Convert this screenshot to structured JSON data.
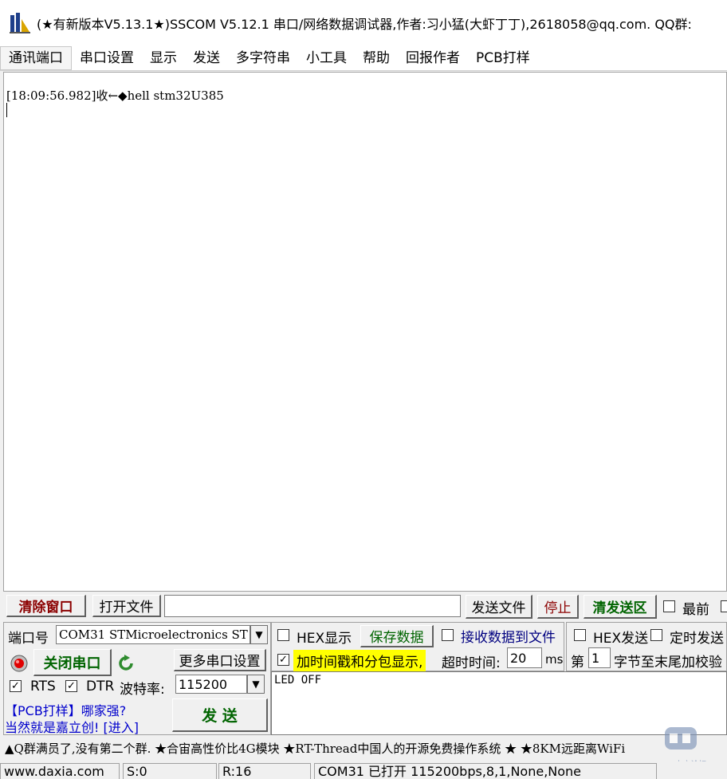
{
  "window": {
    "title": "(★有新版本V5.13.1★)SSCOM V5.12.1 串口/网络数据调试器,作者:习小猛(大虾丁丁),2618058@qq.com. QQ群:"
  },
  "menu": {
    "items": [
      "通讯端口",
      "串口设置",
      "显示",
      "发送",
      "多字符串",
      "小工具",
      "帮助",
      "回报作者",
      "PCB打样"
    ]
  },
  "receive": {
    "line": "[18:09:56.982]收←◆hell stm32U385"
  },
  "toolbar": {
    "clear_window": "清除窗口",
    "open_file": "打开文件",
    "file_path": "",
    "send_file": "发送文件",
    "stop": "停止",
    "clear_send": "清发送区",
    "topmost": "最前"
  },
  "port": {
    "label": "端口号",
    "value": "COM31 STMicroelectronics ST",
    "close_port": "关闭串口",
    "more_settings": "更多串口设置",
    "rts_label": "RTS",
    "dtr_label": "DTR",
    "baud_label": "波特率:",
    "baud_value": "115200",
    "rts_checked": "✓",
    "dtr_checked": "✓"
  },
  "options": {
    "hex_display": "HEX显示",
    "save_data": "保存数据",
    "recv_to_file": "接收数据到文件",
    "hex_send": "HEX发送",
    "timed_send": "定时发送",
    "timestamp": "加时间戳和分包显示,",
    "timestamp_checked": "✓",
    "timeout_label": "超时时间:",
    "timeout_value": "20",
    "timeout_unit": "ms",
    "byte_prefix": "第",
    "byte_value": "1",
    "byte_suffix": "字节至末尾加校验"
  },
  "send": {
    "text": "LED OFF",
    "button": "发  送"
  },
  "promo": {
    "line1": "【PCB打样】哪家强?",
    "line2": "当然就是嘉立创! [进入]"
  },
  "ticker": {
    "text": "▲Q群满员了,没有第二个群. ★合宙高性价比4G模块 ★RT-Thread中国人的开源免费操作系统 ★ ★8KM远距离WiFi"
  },
  "status": {
    "site": "www.daxia.com",
    "sent": "S:0",
    "received": "R:16",
    "port_state": "COM31 已打开  115200bps,8,1,None,None"
  },
  "watermark": "ST中文论坛",
  "colors": {
    "clear_window_text": "#8b0000",
    "green_button_text": "#006400",
    "stop_text": "#8b0000",
    "timestamp_highlight": "#ffff00",
    "link_blue": "#0000cc",
    "refresh_green": "#2e8b2e"
  }
}
